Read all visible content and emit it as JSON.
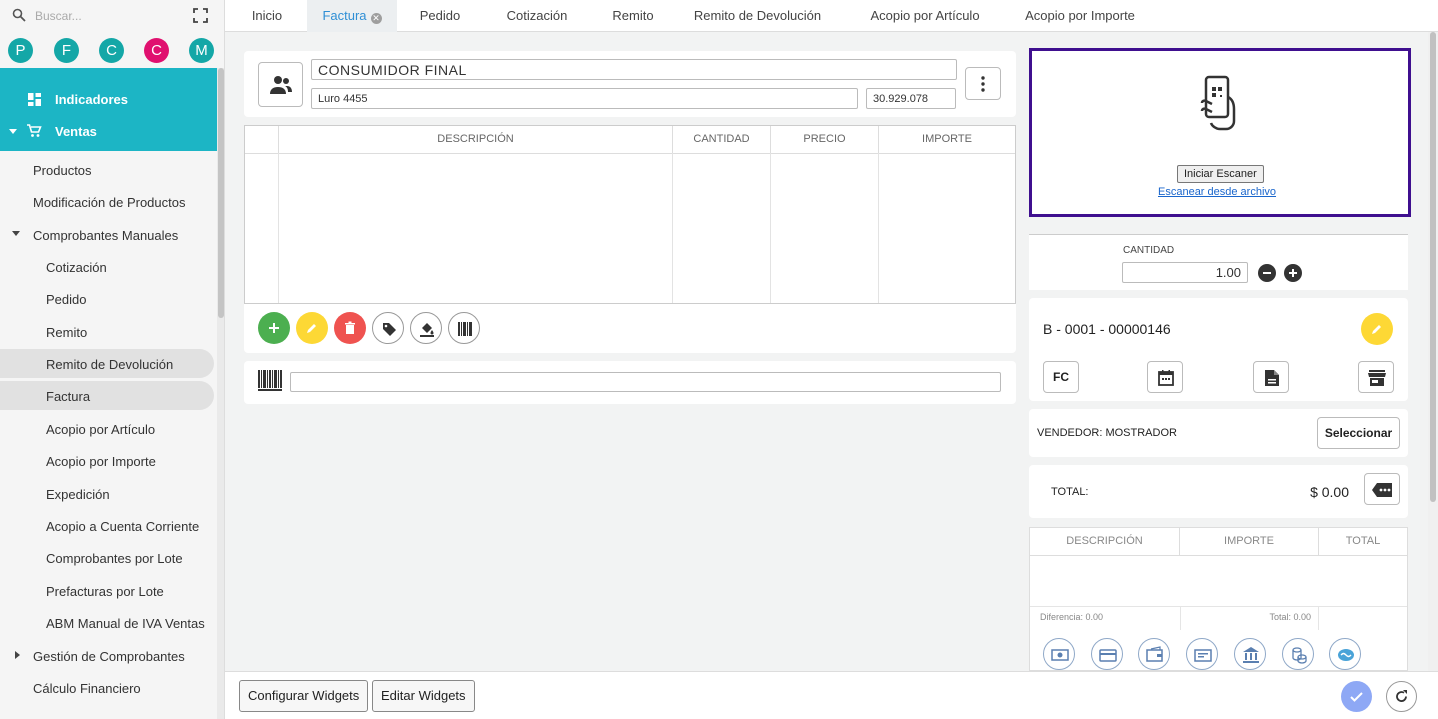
{
  "sidebar": {
    "search_placeholder": "Buscar...",
    "avatars": [
      {
        "letter": "P",
        "color": "#14a7a7"
      },
      {
        "letter": "F",
        "color": "#14a7a7"
      },
      {
        "letter": "C",
        "color": "#14a7a7"
      },
      {
        "letter": "C",
        "color": "#e0106f"
      },
      {
        "letter": "M",
        "color": "#14a7a7"
      }
    ],
    "top_items": [
      "Indicadores",
      "Ventas"
    ],
    "items": [
      "Productos",
      "Modificación de Productos",
      "Comprobantes Manuales",
      "Cotización",
      "Pedido",
      "Remito",
      "Remito de Devolución",
      "Factura",
      "Acopio por Artículo",
      "Acopio por Importe",
      "Expedición",
      "Acopio a Cuenta Corriente",
      "Comprobantes por Lote",
      "Prefacturas por Lote",
      "ABM Manual de IVA Ventas",
      "Gestión de Comprobantes",
      "Cálculo Financiero"
    ]
  },
  "tabs": [
    "Inicio",
    "Factura",
    "Pedido",
    "Cotización",
    "Remito",
    "Remito de Devolución",
    "Acopio por Artículo",
    "Acopio por Importe"
  ],
  "customer": {
    "name": "CONSUMIDOR FINAL",
    "address": "Luro 4455",
    "id_number": "30.929.078"
  },
  "items_grid": {
    "headers": [
      "DESCRIPCIÓN",
      "CANTIDAD",
      "PRECIO",
      "IMPORTE"
    ]
  },
  "scanner": {
    "start_button": "Iniciar Escaner",
    "file_link": "Escanear desde archivo"
  },
  "quantity": {
    "label": "CANTIDAD",
    "value": "1.00"
  },
  "document": {
    "number": "B - 0001 - 00000146",
    "type_label": "FC"
  },
  "seller": {
    "label": "VENDEDOR: MOSTRADOR",
    "select_button": "Seleccionar"
  },
  "total": {
    "label": "TOTAL:",
    "value": "$ 0.00"
  },
  "payments_grid": {
    "headers": [
      "DESCRIPCIÓN",
      "IMPORTE",
      "TOTAL"
    ],
    "diff_label": "Diferencia: 0.00",
    "total_label": "Total: 0.00"
  },
  "footer": {
    "configure_widgets": "Configurar Widgets",
    "edit_widgets": "Editar Widgets"
  },
  "colors": {
    "accent": "#1cb5c5",
    "scanner_border": "#3f0f8f",
    "add": "#4caf50",
    "edit": "#fdd835",
    "delete": "#ef5350",
    "confirm": "#8ea8f5"
  }
}
